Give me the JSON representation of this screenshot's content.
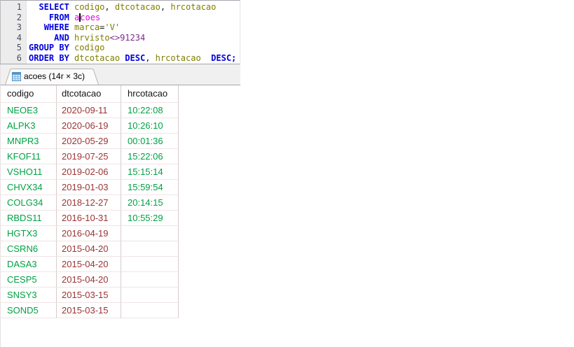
{
  "colors": {
    "plain": "#1a1a1a",
    "kw": "#0000e0",
    "id": "#7e7e00",
    "tbl": "#e800e8",
    "str": "#7e7e00",
    "num": "#7d2b8d",
    "cell_green": "#00a144",
    "cell_maroon": "#9b3333",
    "tab_icon_blue": "#4e93c8"
  },
  "editor": {
    "lines": [
      {
        "no": "1",
        "segs": [
          [
            "plain",
            "  "
          ],
          [
            "kw",
            "SELECT"
          ],
          [
            "plain",
            " "
          ],
          [
            "id",
            "codigo"
          ],
          [
            "plain",
            ", "
          ],
          [
            "id",
            "dtcotacao"
          ],
          [
            "plain",
            ", "
          ],
          [
            "id",
            "hrcotacao"
          ]
        ]
      },
      {
        "no": "2",
        "segs": [
          [
            "plain",
            "    "
          ],
          [
            "kw",
            "FROM"
          ],
          [
            "plain",
            " "
          ],
          [
            "tbl",
            "a"
          ],
          [
            "caret",
            ""
          ],
          [
            "tbl",
            "coes"
          ]
        ]
      },
      {
        "no": "3",
        "segs": [
          [
            "plain",
            "   "
          ],
          [
            "kw",
            "WHERE"
          ],
          [
            "plain",
            " "
          ],
          [
            "id",
            "marca"
          ],
          [
            "plain",
            "="
          ],
          [
            "str",
            "'V'"
          ]
        ]
      },
      {
        "no": "4",
        "segs": [
          [
            "plain",
            "     "
          ],
          [
            "kw",
            "AND"
          ],
          [
            "plain",
            " "
          ],
          [
            "id",
            "hrvisto"
          ],
          [
            "num",
            "<>91234"
          ]
        ]
      },
      {
        "no": "5",
        "segs": [
          [
            "kw",
            "GROUP BY"
          ],
          [
            "plain",
            " "
          ],
          [
            "id",
            "codigo"
          ]
        ]
      },
      {
        "no": "6",
        "segs": [
          [
            "kw",
            "ORDER BY"
          ],
          [
            "plain",
            " "
          ],
          [
            "id",
            "dtcotacao"
          ],
          [
            "plain",
            " "
          ],
          [
            "kw",
            "DESC"
          ],
          [
            "plain",
            ", "
          ],
          [
            "id",
            "hrcotacao"
          ],
          [
            "plain",
            "  "
          ],
          [
            "kw",
            "DESC;"
          ]
        ]
      }
    ]
  },
  "tab": {
    "label": "acoes (14r × 3c)"
  },
  "results": {
    "columns": [
      "codigo",
      "dtcotacao",
      "hrcotacao"
    ],
    "rows": [
      [
        "NEOE3",
        "2020-09-11",
        "10:22:08"
      ],
      [
        "ALPK3",
        "2020-06-19",
        "10:26:10"
      ],
      [
        "MNPR3",
        "2020-05-29",
        "00:01:36"
      ],
      [
        "KFOF11",
        "2019-07-25",
        "15:22:06"
      ],
      [
        "VSHO11",
        "2019-02-06",
        "15:15:14"
      ],
      [
        "CHVX34",
        "2019-01-03",
        "15:59:54"
      ],
      [
        "COLG34",
        "2018-12-27",
        "20:14:15"
      ],
      [
        "RBDS11",
        "2016-10-31",
        "10:55:29"
      ],
      [
        "HGTX3",
        "2016-04-19",
        ""
      ],
      [
        "CSRN6",
        "2015-04-20",
        ""
      ],
      [
        "DASA3",
        "2015-04-20",
        ""
      ],
      [
        "CESP5",
        "2015-04-20",
        ""
      ],
      [
        "SNSY3",
        "2015-03-15",
        ""
      ],
      [
        "SOND5",
        "2015-03-15",
        ""
      ]
    ]
  }
}
